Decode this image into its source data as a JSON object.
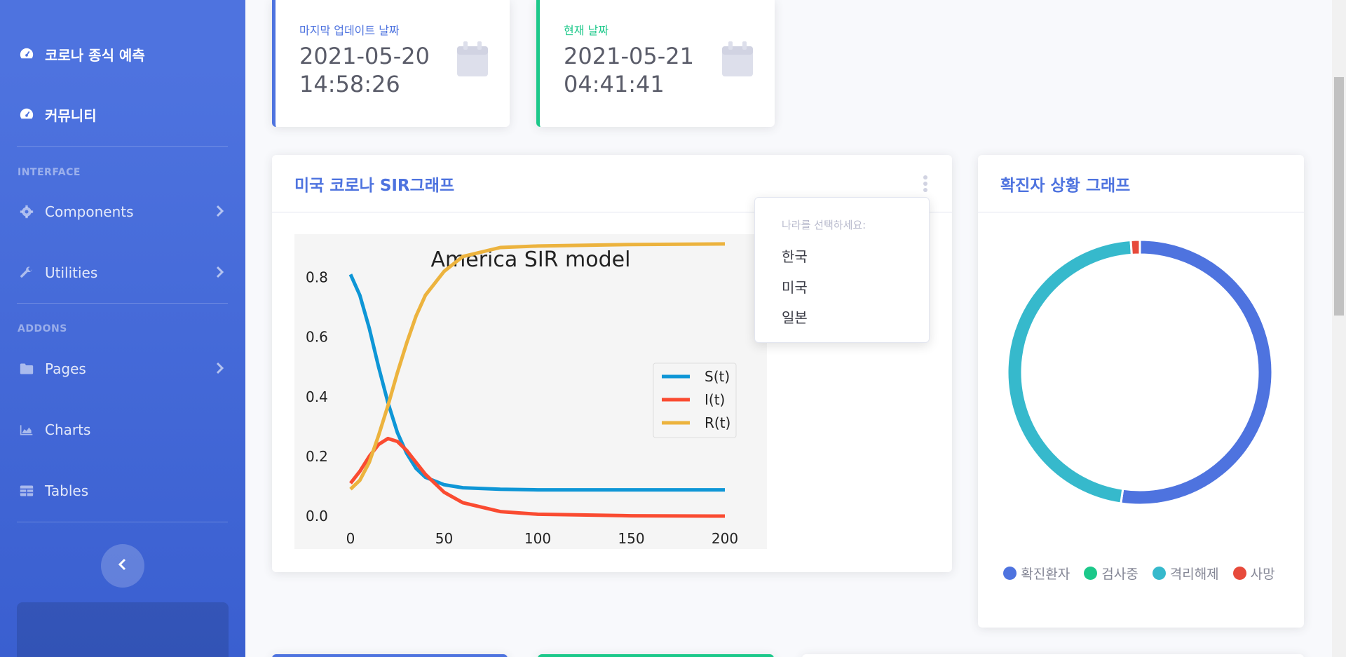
{
  "sidebar": {
    "items": [
      {
        "label": "코로나 종식 예측",
        "icon": "tachometer-icon"
      },
      {
        "label": "커뮤니티",
        "icon": "tachometer-icon"
      }
    ],
    "heading_interface": "INTERFACE",
    "interface_items": [
      {
        "label": "Components",
        "icon": "gear-icon"
      },
      {
        "label": "Utilities",
        "icon": "wrench-icon"
      }
    ],
    "heading_addons": "ADDONS",
    "addon_items": [
      {
        "label": "Pages",
        "icon": "folder-icon"
      },
      {
        "label": "Charts",
        "icon": "area-chart-icon"
      },
      {
        "label": "Tables",
        "icon": "table-icon"
      }
    ]
  },
  "stats": [
    {
      "label": "마지막 업데이트 날짜",
      "value": "2021-05-20 14:58:26",
      "color": "#4e73df"
    },
    {
      "label": "현재 날짜",
      "value": "2021-05-21 04:41:41",
      "color": "#1cc88a"
    }
  ],
  "sir_card": {
    "title": "미국 코로나 SIR그래프",
    "dropdown": {
      "header": "나라를 선택하세요:",
      "options": [
        "한국",
        "미국",
        "일본"
      ]
    }
  },
  "donut_card": {
    "title": "확진자 상황 그래프"
  },
  "chart_data": [
    {
      "type": "line",
      "title": "America SIR model",
      "x_ticks": [
        "0",
        "50",
        "100",
        "150",
        "200"
      ],
      "y_ticks": [
        "0.0",
        "0.2",
        "0.4",
        "0.6",
        "0.8"
      ],
      "xlim": [
        0,
        200
      ],
      "ylim": [
        0,
        0.9
      ],
      "series": [
        {
          "name": "S(t)",
          "color": "#0e96d6",
          "x": [
            0,
            5,
            10,
            15,
            20,
            25,
            30,
            35,
            40,
            50,
            60,
            80,
            100,
            150,
            200
          ],
          "values": [
            0.81,
            0.74,
            0.63,
            0.5,
            0.38,
            0.28,
            0.21,
            0.16,
            0.13,
            0.105,
            0.095,
            0.09,
            0.088,
            0.088,
            0.088
          ]
        },
        {
          "name": "I(t)",
          "color": "#fa4b31",
          "x": [
            0,
            5,
            10,
            15,
            20,
            25,
            30,
            35,
            40,
            50,
            60,
            80,
            100,
            150,
            200
          ],
          "values": [
            0.11,
            0.15,
            0.2,
            0.24,
            0.26,
            0.25,
            0.22,
            0.18,
            0.14,
            0.08,
            0.045,
            0.015,
            0.006,
            0.001,
            0.0
          ]
        },
        {
          "name": "R(t)",
          "color": "#ecb33e",
          "x": [
            0,
            5,
            10,
            15,
            20,
            25,
            30,
            35,
            40,
            50,
            60,
            80,
            100,
            150,
            200
          ],
          "values": [
            0.09,
            0.12,
            0.18,
            0.27,
            0.37,
            0.48,
            0.58,
            0.67,
            0.74,
            0.82,
            0.87,
            0.9,
            0.905,
            0.91,
            0.912
          ]
        }
      ],
      "legend": "right-center",
      "background": "#f5f5f5"
    },
    {
      "type": "pie",
      "variant": "donut",
      "categories": [
        "확진환자",
        "검사중",
        "격리해제",
        "사망"
      ],
      "values": [
        52.3,
        0,
        46.6,
        1.1
      ],
      "colors": [
        "#4e73df",
        "#1cc88a",
        "#36b9cc",
        "#e74a3b"
      ]
    }
  ]
}
